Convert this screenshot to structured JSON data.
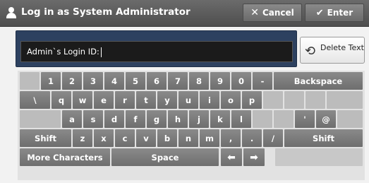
{
  "header": {
    "title": "Log in as System Administrator",
    "cancel_label": "Cancel",
    "enter_label": "Enter",
    "user_icon": "user-icon",
    "cancel_icon": "x-icon",
    "enter_icon": "checkmark-icon"
  },
  "input": {
    "label": "Admin`s Login ID:",
    "value": ""
  },
  "delete_button": {
    "label": "Delete Text",
    "icon": "undo-icon"
  },
  "keyboard": {
    "row1": [
      "1",
      "2",
      "3",
      "4",
      "5",
      "6",
      "7",
      "8",
      "9",
      "0",
      "-"
    ],
    "row1_backspace": "Backspace",
    "row2": [
      "\\",
      "q",
      "w",
      "e",
      "r",
      "t",
      "y",
      "u",
      "i",
      "o",
      "p"
    ],
    "row3": [
      "a",
      "s",
      "d",
      "f",
      "g",
      "h",
      "j",
      "k",
      "l"
    ],
    "row3_extra": [
      "'",
      "@"
    ],
    "row4_shift_left": "Shift",
    "row4": [
      "z",
      "x",
      "c",
      "v",
      "b",
      "n",
      "m",
      ",",
      ".",
      "/"
    ],
    "row4_shift_right": "Shift",
    "more_characters": "More Characters",
    "space": "Space",
    "arrow_left": "⬅",
    "arrow_right": "➡"
  }
}
